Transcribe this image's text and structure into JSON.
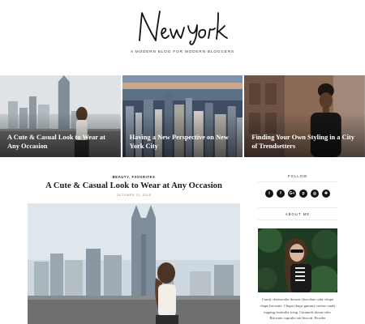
{
  "site": {
    "logo_text": "New York",
    "tagline": "A MODERN BLOG FOR MODERN BLOGGERS"
  },
  "featured": [
    {
      "title": "A Cute & Casual Look to Wear at Any Occasion"
    },
    {
      "title": "Having a New Perspective on New York City"
    },
    {
      "title": "Finding Your Own Styling in a City of Trendsetters"
    }
  ],
  "post": {
    "categories": "BEAUTY, FAVORITES",
    "title": "A Cute & Casual Look to Wear at Any Occasion",
    "date": "OCTOBER 21, 2015"
  },
  "sidebar": {
    "follow_title": "FOLLOW",
    "social_icons": [
      {
        "name": "twitter-icon",
        "glyph": "t"
      },
      {
        "name": "facebook-icon",
        "glyph": "f"
      },
      {
        "name": "google-plus-icon",
        "glyph": "G+"
      },
      {
        "name": "pinterest-icon",
        "glyph": "p"
      },
      {
        "name": "instagram-icon",
        "glyph": "◎"
      },
      {
        "name": "bloglovin-icon",
        "glyph": "✚"
      }
    ],
    "about_title": "ABOUT ME",
    "about_text": "Candy cheesecake dessert chocolate cake chupa chups brownie. Chupa chups gummy cotton candy topping fruitcake icing. Caramels donut cake. Brownie cupcake tart biscuit. Powder"
  },
  "colors": {
    "background": "#ffffff",
    "text": "#222222",
    "overlay_text": "#ffffff",
    "icon_bg": "#111111"
  }
}
